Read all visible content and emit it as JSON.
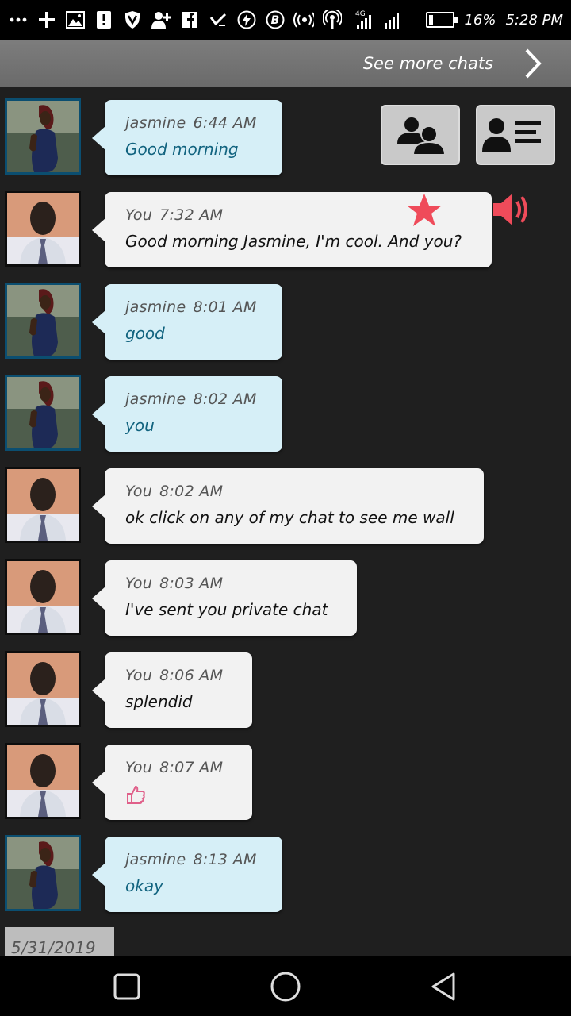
{
  "status_bar": {
    "battery_percent": 16,
    "battery_label": "16%",
    "time": "5:28 PM",
    "network_type": "4G",
    "icons": [
      "more-icon",
      "add-icon",
      "image-icon",
      "alert-icon",
      "shield-icon",
      "add-user-icon",
      "facebook-icon",
      "check-icon",
      "flash-icon",
      "bitcoin-icon",
      "hotspot-icon",
      "podcast-icon",
      "signal-icon",
      "signal-icon",
      "battery-icon"
    ]
  },
  "header": {
    "see_more_label": "See more chats",
    "chevron_icon": "chevron-right-icon"
  },
  "actions": {
    "group_icon": "group-users-icon",
    "profile_icon": "profile-card-icon",
    "star_icon": "star-icon",
    "speaker_icon": "speaker-icon"
  },
  "messages": [
    {
      "sender": "jasmine",
      "time": "6:44 AM",
      "text": "Good morning",
      "from": "her"
    },
    {
      "sender": "You",
      "time": "7:32 AM",
      "text": "Good morning Jasmine, I'm cool. And you?",
      "from": "me"
    },
    {
      "sender": "jasmine",
      "time": "8:01 AM",
      "text": "good",
      "from": "her"
    },
    {
      "sender": "jasmine",
      "time": "8:02 AM",
      "text": "you",
      "from": "her"
    },
    {
      "sender": "You",
      "time": "8:02 AM",
      "text": "ok click on any of my chat to see me wall",
      "from": "me"
    },
    {
      "sender": "You",
      "time": "8:03 AM",
      "text": "I've sent you private chat",
      "from": "me"
    },
    {
      "sender": "You",
      "time": "8:06 AM",
      "text": "splendid",
      "from": "me"
    },
    {
      "sender": "You",
      "time": "8:07 AM",
      "text": "",
      "emoji": "thumbs-up-icon",
      "from": "me"
    },
    {
      "sender": "jasmine",
      "time": "8:13 AM",
      "text": "okay",
      "from": "her"
    }
  ],
  "date_label": "5/31/2019",
  "nav": {
    "recent": "recent-apps-icon",
    "home": "home-icon",
    "back": "back-icon"
  },
  "colors": {
    "her_bubble": "#d6eff7",
    "me_bubble": "#f2f2f2",
    "her_text": "#11637f",
    "accent_red": "#ef4b5a"
  }
}
